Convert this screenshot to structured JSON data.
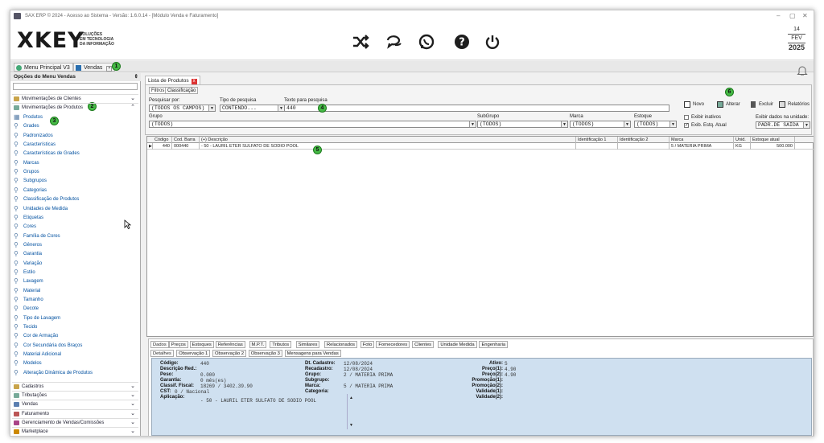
{
  "title": "SAX ERP © 2024 - Acesso ao Sistema - Versão: 1.6.0.14 - [Módulo Venda e Faturamento]",
  "logo": {
    "mark": "XKEY",
    "l1": "SOLUÇÕES",
    "l2": "EM TECNOLOGIA",
    "l3": "DA INFORMAÇÃO"
  },
  "header_icons": [
    "shuffle-icon",
    "chat-icon",
    "whatsapp-icon",
    "help-icon",
    "power-icon"
  ],
  "date": {
    "day": "14",
    "month": "FEV",
    "year": "2025"
  },
  "tabs": {
    "menu": "Menu Principal V3",
    "vendas": "Vendas"
  },
  "badges": [
    "1",
    "2",
    "3",
    "4",
    "5",
    "6"
  ],
  "sidebar": {
    "title": "Opções do Menu Vendas",
    "sections_top": [
      {
        "label": "Movimentações de Clientes",
        "chev": "⌄"
      },
      {
        "label": "Movimentações de Produtos",
        "chev": "⌃"
      }
    ],
    "items": [
      "Produtos",
      "Grades",
      "Padronizados",
      "Características",
      "Características de Grades",
      "Marcas",
      "Grupos",
      "Subgrupos",
      "Categorias",
      "Classificação de Produtos",
      "Unidades de Medida",
      "Etiquetas",
      "Cores",
      "Família de Cores",
      "Gêneros",
      "Garantia",
      "Variação",
      "Estilo",
      "Lavagem",
      "Material",
      "Tamanho",
      "Decote",
      "Tipo de Lavagem",
      "Tecido",
      "Cor de Armação",
      "Cor Secundária dos Braços",
      "Material Adicional",
      "Modelos",
      "Alteração Dinâmica de Produtos"
    ],
    "sections_bottom": [
      {
        "label": "Cadastros",
        "chev": "⌄"
      },
      {
        "label": "Tributações",
        "chev": "⌄"
      },
      {
        "label": "Vendas",
        "chev": "⌄"
      },
      {
        "label": "Faturamento",
        "chev": "⌄"
      },
      {
        "label": "Gerenciamento de Vendas/Comissões",
        "chev": "⌄"
      },
      {
        "label": "Marketplace",
        "chev": "⌄"
      }
    ]
  },
  "main": {
    "tab": "Lista de Produtos",
    "tab_close": "x",
    "ftabs": [
      "Filtros",
      "Classificação"
    ],
    "filters": {
      "pesq_label": "Pesquisar por:",
      "pesq_val": "(TODOS OS CAMPOS)",
      "tipo_label": "Tipo de pesquisa",
      "tipo_val": "CONTENDO...",
      "texto_label": "Texto para pesquisa",
      "texto_val": "440",
      "grupo_label": "Grupo",
      "grupo_val": "(TODOS)",
      "sub_label": "SubGrupo",
      "sub_val": "(TODOS)",
      "marca_label": "Marca",
      "marca_val": "(TODOS)",
      "estoque_label": "Estoque",
      "estoque_val": "(TODOS)"
    },
    "ops": {
      "novo": "Novo",
      "alterar": "Alterar",
      "excluir": "Excluir",
      "relatorios": "Relatórios",
      "inativos": "Exibir inativos",
      "estq": "Exib. Estq. Atual",
      "unidade_label": "Exibir dados na unidade:",
      "unidade_val": "PADR.DE SAÍDA",
      "estq_checked": "✓"
    },
    "grid": {
      "headers": [
        "Código",
        "Cod. Barra",
        "(+) Descrição",
        "Identificação 1",
        "Identificação 2",
        "Marca",
        "Unid.",
        "Estoque atual"
      ],
      "row": [
        "440",
        "000440",
        "- 50 - LAURIL ETER SULFATO DE SODIO POOL",
        "",
        "",
        "5 / MATERIA PRIMA",
        "KG",
        "500.000"
      ],
      "row_marker": "▶"
    },
    "btabs1": [
      "Dados",
      "Preços",
      "Estoques",
      "Referências",
      "M.P.T.",
      "Tributos",
      "Similares",
      "Relacionados",
      "Foto",
      "Fornecedores",
      "Clientes",
      "Unidade Medida",
      "Engenharia"
    ],
    "btabs2": [
      "Detalhes",
      "Observação 1",
      "Observação 2",
      "Observação 3",
      "Mensagens para Vendas"
    ],
    "details": {
      "codigo_k": "Código:",
      "codigo_v": "440",
      "descred_k": "Descrição Red.:",
      "descred_v": "",
      "peso_k": "Peso:",
      "peso_v": "0.000",
      "garantia_k": "Garantia:",
      "garantia_v": "0 mês(es)",
      "classif_k": "Classif. Fiscal:",
      "classif_v": "18269 / 3402.39.90",
      "cst_k": "CST:",
      "cst_v": "0 / Nacional",
      "aplic_k": "Aplicação:",
      "aplic_v": "- 50 - LAURIL ETER SULFATO DE SODIO POOL",
      "dtcad_k": "Dt. Cadastro:",
      "dtcad_v": "12/08/2024",
      "recad_k": "Recadastro:",
      "recad_v": "12/08/2024",
      "grupo_k": "Grupo:",
      "grupo_v": "2 / MATERIA PRIMA",
      "subgrupo_k": "Subgrupo:",
      "subgrupo_v": "",
      "marca_k": "Marca:",
      "marca_v": "5 / MATERIA PRIMA",
      "categoria_k": "Categoria:",
      "categoria_v": "",
      "ativo_k": "Ativo:",
      "ativo_v": "S",
      "preco1_k": "Preço(1):",
      "preco1_v": "4.90",
      "preco2_k": "Preço(2):",
      "preco2_v": "4.90",
      "promo1_k": "Promoção(1):",
      "promo1_v": "",
      "promo2_k": "Promoção(2):",
      "promo2_v": "",
      "val1_k": "Validade(1):",
      "val1_v": "",
      "val2_k": "Validade(2):",
      "val2_v": ""
    }
  }
}
